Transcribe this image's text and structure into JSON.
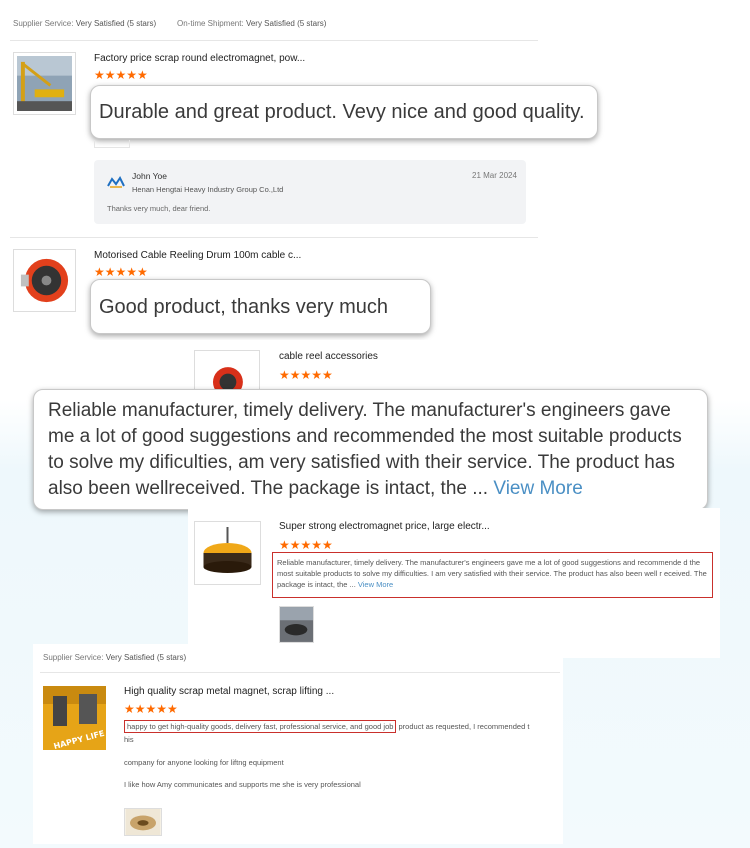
{
  "top_panel": {
    "supplier_service_label": "Supplier Service:",
    "supplier_service_value": "Very Satisfied  (5 stars)",
    "shipment_label": "On-time Shipment:",
    "shipment_value": "Very Satisfied  (5 stars)"
  },
  "review1": {
    "title": "Factory price scrap round electromagnet, pow...",
    "stars": "★★★★★",
    "callout": "Durable and great product. Vevy nice and good quality.",
    "reply": {
      "name": "John Yoe",
      "company": "Henan Hengtai Heavy Industry Group Co.,Ltd",
      "date": "21 Mar 2024",
      "text": "Thanks very much, dear friend."
    }
  },
  "review2": {
    "title": "Motorised Cable Reeling Drum 100m cable c...",
    "stars": "★★★★★",
    "callout": "Good product, thanks very much"
  },
  "review3": {
    "title": "cable reel accessories",
    "stars": "★★★★★"
  },
  "big_callout": {
    "text": "Reliable manufacturer, timely delivery. The manufacturer's engineers gave me a lot of good suggestions and recommended the most suitable products to solve my dificulties, am very satisfied with their service. The product has also been wellreceived. The package is intact, the ...",
    "view_more": "View More"
  },
  "review4": {
    "title": "Super strong electromagnet price, large electr...",
    "stars": "★★★★★",
    "text": "Reliable manufacturer, timely delivery. The manufacturer's engineers gave me a lot of good suggestions and recommende d the most suitable products to solve my difficulties. I am very satisfied with their service. The product has also been well r eceived. The package is intact, the ...",
    "view_more": "View More"
  },
  "review5": {
    "supplier_service_label": "Supplier Service:",
    "supplier_service_value": "Very Satisfied  (5 stars)",
    "title": "High quality scrap metal magnet, scrap lifting ...",
    "stars": "★★★★★",
    "highlight": "happy to get high-quality goods, delivery fast, professional service, and good job",
    "text_rest": " product as requested, I recommended  t",
    "text_his": "his",
    "line2": "company for anyone looking for liftng  equipment",
    "line3": "I like how Amy communicates and supports me she is very professional",
    "image_caption": "HAPPY LIFE"
  },
  "colors": {
    "star": "#ff6a00",
    "highlight_border": "#c9302c",
    "link": "#4a8fc4"
  }
}
